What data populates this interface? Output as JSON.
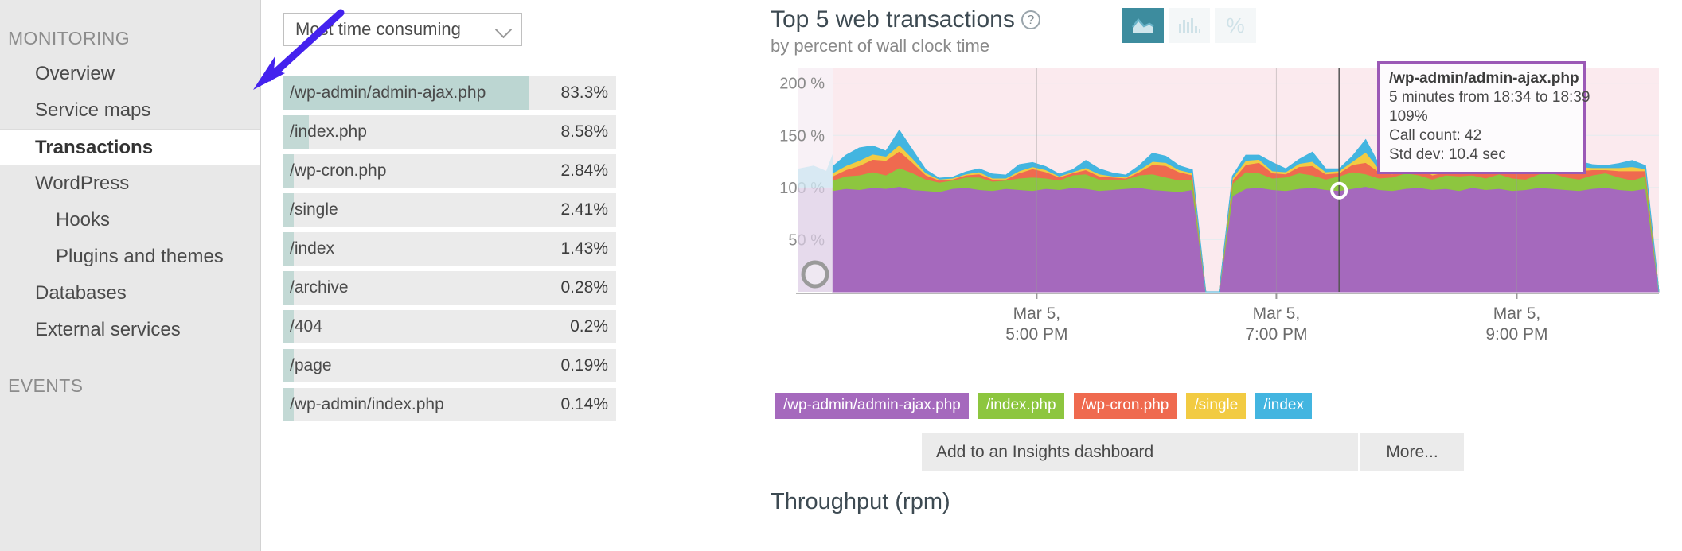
{
  "sidebar": {
    "section_monitoring": "MONITORING",
    "section_events": "EVENTS",
    "items": [
      {
        "label": "Overview",
        "level": 1,
        "active": false
      },
      {
        "label": "Service maps",
        "level": 1,
        "active": false
      },
      {
        "label": "Transactions",
        "level": 1,
        "active": true
      },
      {
        "label": "WordPress",
        "level": 1,
        "active": false
      },
      {
        "label": "Hooks",
        "level": 2,
        "active": false
      },
      {
        "label": "Plugins and themes",
        "level": 2,
        "active": false
      },
      {
        "label": "Databases",
        "level": 1,
        "active": false
      },
      {
        "label": "External services",
        "level": 1,
        "active": false
      }
    ]
  },
  "sort_select": {
    "value": "Most time consuming",
    "icon": "chevron-down-icon"
  },
  "transactions": [
    {
      "name": "/wp-admin/admin-ajax.php",
      "percent": "83.3%",
      "value": 83.3,
      "selected": true
    },
    {
      "name": "/index.php",
      "percent": "8.58%",
      "value": 8.58,
      "selected": false
    },
    {
      "name": "/wp-cron.php",
      "percent": "2.84%",
      "value": 2.84,
      "selected": false
    },
    {
      "name": "/single",
      "percent": "2.41%",
      "value": 2.41,
      "selected": false
    },
    {
      "name": "/index",
      "percent": "1.43%",
      "value": 1.43,
      "selected": false
    },
    {
      "name": "/archive",
      "percent": "0.28%",
      "value": 0.28,
      "selected": false
    },
    {
      "name": "/404",
      "percent": "0.2%",
      "value": 0.2,
      "selected": false
    },
    {
      "name": "/page",
      "percent": "0.19%",
      "value": 0.19,
      "selected": false
    },
    {
      "name": "/wp-admin/index.php",
      "percent": "0.14%",
      "value": 0.14,
      "selected": false
    }
  ],
  "chart_panel": {
    "title": "Top 5 web transactions",
    "subtitle": "by percent of wall clock time",
    "help_icon": "question-mark-circle-icon",
    "toggles": [
      {
        "name": "area-chart-icon",
        "active": true
      },
      {
        "name": "bar-chart-icon",
        "active": false
      },
      {
        "name": "percent-icon",
        "active": false
      }
    ],
    "tooltip": {
      "title": "/wp-admin/admin-ajax.php",
      "range": "5 minutes from 18:34 to 18:39",
      "percent": "109%",
      "call_count": "Call count: 42",
      "std_dev": "Std dev: 10.4 sec",
      "border_color": "#9b59b6"
    },
    "footer": {
      "add_dashboard": "Add to an Insights dashboard",
      "more": "More..."
    }
  },
  "throughput_title": "Throughput (rpm)",
  "annotation": {
    "arrow_color": "#4422ee",
    "name": "pointer-arrow"
  },
  "chart_data": {
    "type": "area",
    "title": "Top 5 web transactions",
    "subtitle": "by percent of wall clock time",
    "xlabel": "",
    "ylabel": "%",
    "ylim": [
      0,
      215
    ],
    "yticks": [
      50,
      100,
      150,
      200
    ],
    "ytick_labels": [
      "50 %",
      "100 %",
      "150 %",
      "200 %"
    ],
    "grid": true,
    "stacked": true,
    "legend_position": "bottom",
    "xticks": [
      {
        "label_line1": "Mar 5,",
        "label_line2": "5:00 PM",
        "pos": 0.247
      },
      {
        "label_line1": "Mar 5,",
        "label_line2": "7:00 PM",
        "pos": 0.537
      },
      {
        "label_line1": "Mar 5,",
        "label_line2": "9:00 PM",
        "pos": 0.828
      }
    ],
    "series": [
      {
        "name": "/wp-admin/admin-ajax.php",
        "color": "#a569bd",
        "values": [
          97,
          99,
          98,
          100,
          99,
          101,
          98,
          97,
          96,
          99,
          100,
          98,
          97,
          99,
          98,
          97,
          99,
          98,
          100,
          99,
          97,
          98,
          99,
          100,
          98,
          97,
          96,
          98,
          0,
          0,
          92,
          99,
          100,
          98,
          97,
          99,
          100,
          98,
          97,
          99,
          101,
          98,
          97,
          99,
          100,
          98,
          99,
          97,
          100,
          98,
          99,
          97,
          98,
          100,
          99,
          98,
          97,
          99,
          100,
          98,
          97,
          99,
          0
        ]
      },
      {
        "name": "/index.php",
        "color": "#8dc63f",
        "values": [
          10,
          12,
          14,
          15,
          13,
          18,
          16,
          11,
          9,
          8,
          10,
          12,
          9,
          8,
          11,
          13,
          10,
          9,
          12,
          14,
          11,
          10,
          9,
          12,
          15,
          13,
          11,
          10,
          0,
          0,
          12,
          16,
          14,
          11,
          13,
          15,
          12,
          10,
          14,
          16,
          12,
          11,
          13,
          15,
          12,
          10,
          13,
          14,
          12,
          11,
          14,
          12,
          10,
          13,
          15,
          12,
          11,
          13,
          14,
          12,
          10,
          12,
          0
        ]
      },
      {
        "name": "/wp-cron.php",
        "color": "#ef6a4f",
        "values": [
          4,
          6,
          9,
          12,
          14,
          16,
          10,
          4,
          2,
          1,
          2,
          3,
          2,
          1,
          5,
          8,
          6,
          3,
          2,
          4,
          3,
          2,
          1,
          3,
          9,
          11,
          8,
          4,
          0,
          0,
          3,
          7,
          10,
          5,
          3,
          6,
          9,
          5,
          3,
          7,
          11,
          6,
          3,
          5,
          8,
          4,
          3,
          6,
          9,
          5,
          3,
          5,
          7,
          4,
          3,
          6,
          8,
          5,
          3,
          6,
          9,
          5,
          0
        ]
      },
      {
        "name": "/single",
        "color": "#f2cb42",
        "values": [
          3,
          4,
          5,
          5,
          4,
          6,
          4,
          2,
          1,
          1,
          1,
          2,
          1,
          1,
          2,
          2,
          2,
          1,
          1,
          2,
          2,
          1,
          1,
          2,
          3,
          3,
          2,
          2,
          0,
          0,
          2,
          4,
          3,
          2,
          2,
          3,
          4,
          2,
          2,
          3,
          10,
          3,
          2,
          3,
          4,
          2,
          2,
          3,
          4,
          2,
          2,
          3,
          3,
          2,
          2,
          3,
          4,
          2,
          2,
          3,
          4,
          2,
          0
        ]
      },
      {
        "name": "/index",
        "color": "#43b5e0",
        "values": [
          6,
          10,
          12,
          8,
          5,
          14,
          8,
          3,
          1,
          1,
          2,
          3,
          4,
          3,
          6,
          4,
          3,
          2,
          2,
          7,
          5,
          3,
          2,
          4,
          8,
          6,
          4,
          3,
          0,
          0,
          2,
          5,
          4,
          8,
          3,
          4,
          9,
          3,
          2,
          5,
          12,
          4,
          2,
          3,
          5,
          3,
          2,
          4,
          6,
          3,
          2,
          4,
          5,
          3,
          2,
          4,
          5,
          3,
          2,
          4,
          6,
          3,
          0
        ]
      }
    ],
    "hover_marker": {
      "x_index": 38,
      "series": "/wp-admin/admin-ajax.php",
      "label": "109%"
    }
  }
}
